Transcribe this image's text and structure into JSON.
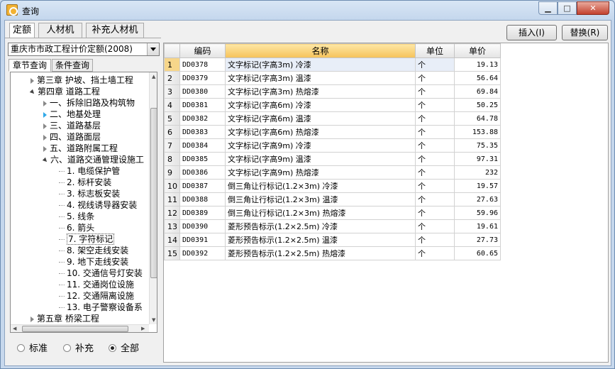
{
  "window": {
    "title": "查询"
  },
  "top_tabs": [
    "定额",
    "人材机",
    "补充人材机"
  ],
  "buttons": {
    "insert": "插入(I)",
    "replace": "替换(R)"
  },
  "quota_select": "重庆市市政工程计价定额(2008)",
  "sub_tabs": [
    "章节查询",
    "条件查询"
  ],
  "tree": [
    {
      "label": "第三章 护坡、挡土墙工程",
      "level": 1,
      "state": "collapsed"
    },
    {
      "label": "第四章 道路工程",
      "level": 1,
      "state": "expanded"
    },
    {
      "label": "一、拆除旧路及构筑物",
      "level": 2,
      "state": "collapsed"
    },
    {
      "label": "二、地基处理",
      "level": 2,
      "state": "collapsed-blue"
    },
    {
      "label": "三、道路基层",
      "level": 2,
      "state": "collapsed"
    },
    {
      "label": "四、道路面层",
      "level": 2,
      "state": "collapsed"
    },
    {
      "label": "五、道路附属工程",
      "level": 2,
      "state": "collapsed"
    },
    {
      "label": "六、道路交通管理设施工",
      "level": 2,
      "state": "expanded"
    },
    {
      "label": "1. 电缆保护管",
      "level": 3,
      "state": "leaf"
    },
    {
      "label": "2. 标杆安装",
      "level": 3,
      "state": "leaf"
    },
    {
      "label": "3. 标志板安装",
      "level": 3,
      "state": "leaf"
    },
    {
      "label": "4. 视线诱导器安装",
      "level": 3,
      "state": "leaf"
    },
    {
      "label": "5. 线条",
      "level": 3,
      "state": "leaf"
    },
    {
      "label": "6. 箭头",
      "level": 3,
      "state": "leaf"
    },
    {
      "label": "7. 字符标记",
      "level": 3,
      "state": "selected"
    },
    {
      "label": "8. 架空走线安装",
      "level": 3,
      "state": "leaf"
    },
    {
      "label": "9. 地下走线安装",
      "level": 3,
      "state": "leaf"
    },
    {
      "label": "10. 交通信号灯安装",
      "level": 3,
      "state": "leaf"
    },
    {
      "label": "11. 交通岗位设施",
      "level": 3,
      "state": "leaf"
    },
    {
      "label": "12. 交通隔离设施",
      "level": 3,
      "state": "leaf"
    },
    {
      "label": "13. 电子警察设备系",
      "level": 3,
      "state": "leaf"
    },
    {
      "label": "第五章 桥梁工程",
      "level": 1,
      "state": "collapsed"
    }
  ],
  "radios": [
    {
      "label": "标准",
      "checked": false
    },
    {
      "label": "补充",
      "checked": false
    },
    {
      "label": "全部",
      "checked": true
    }
  ],
  "grid": {
    "columns": [
      "编码",
      "名称",
      "单位",
      "单价"
    ],
    "rows": [
      {
        "n": "1",
        "code": "DD0378",
        "name": "文字标记(字高3m) 冷漆",
        "unit": "个",
        "price": "19.13"
      },
      {
        "n": "2",
        "code": "DD0379",
        "name": "文字标记(字高3m) 温漆",
        "unit": "个",
        "price": "56.64"
      },
      {
        "n": "3",
        "code": "DD0380",
        "name": "文字标记(字高3m) 热熔漆",
        "unit": "个",
        "price": "69.84"
      },
      {
        "n": "4",
        "code": "DD0381",
        "name": "文字标记(字高6m) 冷漆",
        "unit": "个",
        "price": "50.25"
      },
      {
        "n": "5",
        "code": "DD0382",
        "name": "文字标记(字高6m) 温漆",
        "unit": "个",
        "price": "64.78"
      },
      {
        "n": "6",
        "code": "DD0383",
        "name": "文字标记(字高6m) 热熔漆",
        "unit": "个",
        "price": "153.88"
      },
      {
        "n": "7",
        "code": "DD0384",
        "name": "文字标记(字高9m) 冷漆",
        "unit": "个",
        "price": "75.35"
      },
      {
        "n": "8",
        "code": "DD0385",
        "name": "文字标记(字高9m) 温漆",
        "unit": "个",
        "price": "97.31"
      },
      {
        "n": "9",
        "code": "DD0386",
        "name": "文字标记(字高9m) 热熔漆",
        "unit": "个",
        "price": "232"
      },
      {
        "n": "10",
        "code": "DD0387",
        "name": "倒三角让行标记(1.2×3m) 冷漆",
        "unit": "个",
        "price": "19.57"
      },
      {
        "n": "11",
        "code": "DD0388",
        "name": "倒三角让行标记(1.2×3m) 温漆",
        "unit": "个",
        "price": "27.63"
      },
      {
        "n": "12",
        "code": "DD0389",
        "name": "倒三角让行标记(1.2×3m) 热熔漆",
        "unit": "个",
        "price": "59.96"
      },
      {
        "n": "13",
        "code": "DD0390",
        "name": "菱形预告标示(1.2×2.5m) 冷漆",
        "unit": "个",
        "price": "19.61"
      },
      {
        "n": "14",
        "code": "DD0391",
        "name": "菱形预告标示(1.2×2.5m) 温漆",
        "unit": "个",
        "price": "27.73"
      },
      {
        "n": "15",
        "code": "DD0392",
        "name": "菱形预告标示(1.2×2.5m) 热熔漆",
        "unit": "个",
        "price": "60.65"
      }
    ]
  },
  "icons": [
    "app-icon",
    "minimize-icon",
    "maximize-icon",
    "close-icon",
    "dropdown-arrow-icon"
  ]
}
